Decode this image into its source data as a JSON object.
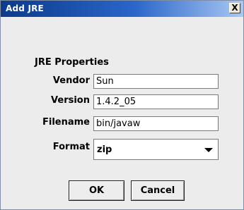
{
  "window": {
    "title": "Add JRE",
    "close_label": "X"
  },
  "form": {
    "heading": "JRE Properties",
    "vendor": {
      "label": "Vendor",
      "value": "Sun"
    },
    "version": {
      "label": "Version",
      "value": "1.4.2_05"
    },
    "filename": {
      "label": "Filename",
      "value": "bin/javaw"
    },
    "format": {
      "label": "Format",
      "selected": "zip"
    }
  },
  "buttons": {
    "ok": "OK",
    "cancel": "Cancel"
  }
}
